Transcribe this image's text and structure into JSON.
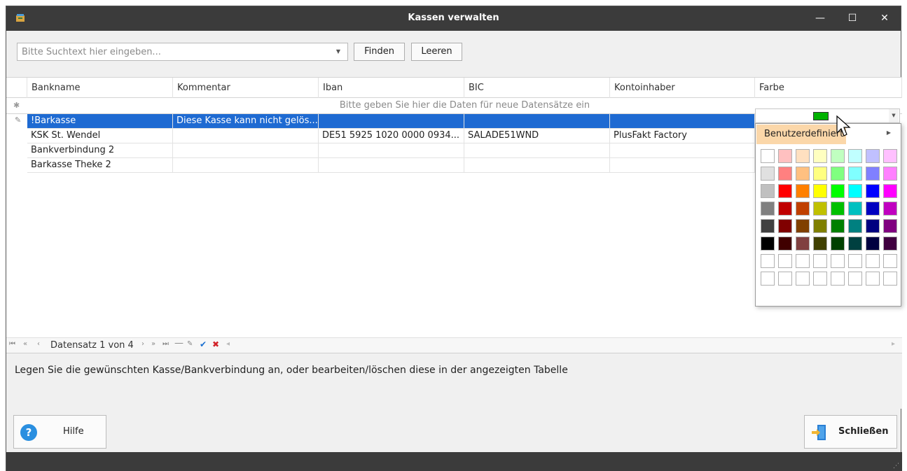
{
  "window": {
    "title": "Kassen verwalten",
    "controls": {
      "minimize": "—",
      "maximize": "☐",
      "close": "✕"
    }
  },
  "search": {
    "placeholder": "Bitte Suchtext hier eingeben...",
    "find_label": "Finden",
    "clear_label": "Leeren"
  },
  "grid": {
    "columns": [
      "Bankname",
      "Kommentar",
      "Iban",
      "BIC",
      "Kontoinhaber",
      "Farbe"
    ],
    "new_row_hint": "Bitte geben Sie hier die Daten  für neue Datensätze ein",
    "rows": [
      {
        "Bankname": "!Barkasse",
        "Kommentar": "Diese Kasse kann nicht gelös...",
        "Iban": "",
        "BIC": "",
        "Kontoinhaber": "",
        "Farbe": "#00b200",
        "selected": true
      },
      {
        "Bankname": "KSK St. Wendel",
        "Kommentar": "",
        "Iban": "DE51 5925 1020 0000 0934...",
        "BIC": "SALADE51WND",
        "Kontoinhaber": "PlusFakt Factory",
        "Farbe": ""
      },
      {
        "Bankname": "Bankverbindung 2",
        "Kommentar": "",
        "Iban": "",
        "BIC": "",
        "Kontoinhaber": "",
        "Farbe": ""
      },
      {
        "Bankname": "Barkasse Theke 2",
        "Kommentar": "",
        "Iban": "",
        "BIC": "",
        "Kontoinhaber": "",
        "Farbe": ""
      }
    ]
  },
  "navigator": {
    "record_text": "Datensatz 1 von 4"
  },
  "color_picker": {
    "tab_label": "Benutzerdefiniert",
    "selected_color": "#00b200",
    "palette": [
      [
        "#ffffff",
        "#ffc0c0",
        "#ffe0c0",
        "#ffffc0",
        "#c0ffc0",
        "#c0ffff",
        "#c0c0ff",
        "#ffc0ff"
      ],
      [
        "#e0e0e0",
        "#ff8080",
        "#ffc080",
        "#ffff80",
        "#80ff80",
        "#80ffff",
        "#8080ff",
        "#ff80ff"
      ],
      [
        "#c0c0c0",
        "#ff0000",
        "#ff8000",
        "#ffff00",
        "#00ff00",
        "#00ffff",
        "#0000ff",
        "#ff00ff"
      ],
      [
        "#808080",
        "#c00000",
        "#c04000",
        "#c0c000",
        "#00c000",
        "#00c0c0",
        "#0000c0",
        "#c000c0"
      ],
      [
        "#404040",
        "#800000",
        "#804000",
        "#808000",
        "#008000",
        "#008080",
        "#000080",
        "#800080"
      ],
      [
        "#000000",
        "#400000",
        "#804040",
        "#404000",
        "#004000",
        "#004040",
        "#000040",
        "#400040"
      ],
      [
        "#ffffff",
        "#ffffff",
        "#ffffff",
        "#ffffff",
        "#ffffff",
        "#ffffff",
        "#ffffff",
        "#ffffff"
      ],
      [
        "#ffffff",
        "#ffffff",
        "#ffffff",
        "#ffffff",
        "#ffffff",
        "#ffffff",
        "#ffffff",
        "#ffffff"
      ]
    ]
  },
  "description": "Legen Sie die gewünschten Kasse/Bankverbindung an, oder bearbeiten/löschen diese in der angezeigten Tabelle",
  "buttons": {
    "help_label": "Hilfe",
    "close_label": "Schließen"
  }
}
